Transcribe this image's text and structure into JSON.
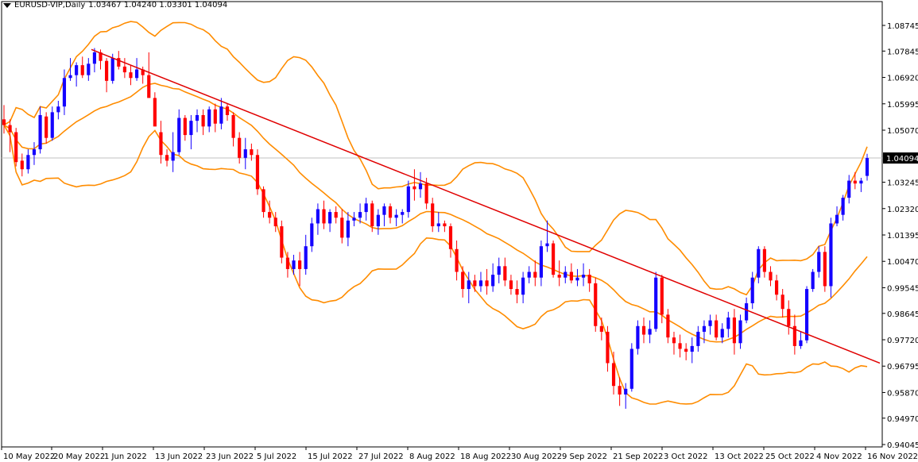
{
  "header": {
    "symbol": "EURUSD-VIP,Daily",
    "ohlc": "1.03467 1.04240 1.03301 1.04094"
  },
  "colors": {
    "bull_candle": "#1400ff",
    "bear_candle": "#ff0000",
    "bollinger": "#ff8c00",
    "trendline": "#e00000",
    "price_line": "#c0c0c0",
    "price_tag_bg": "#000000"
  },
  "chart_data": {
    "type": "candlestick",
    "title": "EURUSD-VIP,Daily",
    "last_price": 1.04094,
    "last_ohlc": {
      "open": 1.03467,
      "high": 1.0424,
      "low": 1.03301,
      "close": 1.04094
    },
    "ylim": [
      0.94,
      1.095
    ],
    "y_ticks": [
      "1.08745",
      "1.07845",
      "1.06920",
      "1.05995",
      "1.05070",
      "1.04094",
      "1.03245",
      "1.02320",
      "1.01395",
      "1.00470",
      "0.99545",
      "0.98645",
      "0.97720",
      "0.96795",
      "0.95870",
      "0.94970",
      "0.94045"
    ],
    "x_ticks": [
      "10 May 2022",
      "20 May 2022",
      "1 Jun 2022",
      "13 Jun 2022",
      "23 Jun 2022",
      "5 Jul 2022",
      "15 Jul 2022",
      "27 Jul 2022",
      "8 Aug 2022",
      "18 Aug 2022",
      "30 Aug 2022",
      "9 Sep 2022",
      "21 Sep 2022",
      "3 Oct 2022",
      "13 Oct 2022",
      "25 Oct 2022",
      "4 Nov 2022",
      "16 Nov 2022"
    ],
    "grid": false,
    "indicator": "Bollinger Bands (upper, middle, lower)",
    "trendline": {
      "start": {
        "date": "25 May 2022",
        "price": 1.079
      },
      "end": {
        "date": "16 Nov 2022",
        "price": 0.969
      }
    },
    "candles": [
      {
        "open": 1.0545,
        "high": 1.0595,
        "low": 1.0495,
        "close": 1.0525
      },
      {
        "open": 1.0525,
        "high": 1.0545,
        "low": 1.043,
        "close": 1.05
      },
      {
        "open": 1.05,
        "high": 1.0515,
        "low": 1.038,
        "close": 1.0395
      },
      {
        "open": 1.04,
        "high": 1.0425,
        "low": 1.0345,
        "close": 1.037
      },
      {
        "open": 1.037,
        "high": 1.044,
        "low": 1.0355,
        "close": 1.042
      },
      {
        "open": 1.042,
        "high": 1.0465,
        "low": 1.0385,
        "close": 1.044
      },
      {
        "open": 1.044,
        "high": 1.059,
        "low": 1.0425,
        "close": 1.056
      },
      {
        "open": 1.0555,
        "high": 1.057,
        "low": 1.046,
        "close": 1.048
      },
      {
        "open": 1.048,
        "high": 1.059,
        "low": 1.047,
        "close": 1.057
      },
      {
        "open": 1.057,
        "high": 1.061,
        "low": 1.0545,
        "close": 1.059
      },
      {
        "open": 1.059,
        "high": 1.072,
        "low": 1.056,
        "close": 1.069
      },
      {
        "open": 1.069,
        "high": 1.076,
        "low": 1.068,
        "close": 1.07
      },
      {
        "open": 1.07,
        "high": 1.0745,
        "low": 1.066,
        "close": 1.0735
      },
      {
        "open": 1.0735,
        "high": 1.0765,
        "low": 1.069,
        "close": 1.07
      },
      {
        "open": 1.07,
        "high": 1.076,
        "low": 1.068,
        "close": 1.074
      },
      {
        "open": 1.074,
        "high": 1.0795,
        "low": 1.071,
        "close": 1.078
      },
      {
        "open": 1.078,
        "high": 1.079,
        "low": 1.072,
        "close": 1.075
      },
      {
        "open": 1.075,
        "high": 1.076,
        "low": 1.064,
        "close": 1.068
      },
      {
        "open": 1.068,
        "high": 1.0775,
        "low": 1.067,
        "close": 1.076
      },
      {
        "open": 1.076,
        "high": 1.0785,
        "low": 1.072,
        "close": 1.073
      },
      {
        "open": 1.073,
        "high": 1.076,
        "low": 1.069,
        "close": 1.071
      },
      {
        "open": 1.071,
        "high": 1.0735,
        "low": 1.0665,
        "close": 1.069
      },
      {
        "open": 1.069,
        "high": 1.076,
        "low": 1.068,
        "close": 1.072
      },
      {
        "open": 1.072,
        "high": 1.073,
        "low": 1.067,
        "close": 1.07
      },
      {
        "open": 1.07,
        "high": 1.078,
        "low": 1.065,
        "close": 1.062
      },
      {
        "open": 1.062,
        "high": 1.064,
        "low": 1.055,
        "close": 1.052
      },
      {
        "open": 1.05,
        "high": 1.054,
        "low": 1.039,
        "close": 1.042
      },
      {
        "open": 1.042,
        "high": 1.044,
        "low": 1.038,
        "close": 1.04
      },
      {
        "open": 1.04,
        "high": 1.05,
        "low": 1.036,
        "close": 1.043
      },
      {
        "open": 1.043,
        "high": 1.058,
        "low": 1.042,
        "close": 1.055
      },
      {
        "open": 1.055,
        "high": 1.056,
        "low": 1.047,
        "close": 1.049
      },
      {
        "open": 1.049,
        "high": 1.056,
        "low": 1.044,
        "close": 1.054
      },
      {
        "open": 1.054,
        "high": 1.058,
        "low": 1.05,
        "close": 1.056
      },
      {
        "open": 1.056,
        "high": 1.058,
        "low": 1.049,
        "close": 1.052
      },
      {
        "open": 1.052,
        "high": 1.059,
        "low": 1.05,
        "close": 1.058
      },
      {
        "open": 1.058,
        "high": 1.06,
        "low": 1.05,
        "close": 1.053
      },
      {
        "open": 1.053,
        "high": 1.062,
        "low": 1.051,
        "close": 1.059
      },
      {
        "open": 1.059,
        "high": 1.06,
        "low": 1.054,
        "close": 1.056
      },
      {
        "open": 1.056,
        "high": 1.057,
        "low": 1.045,
        "close": 1.048
      },
      {
        "open": 1.048,
        "high": 1.05,
        "low": 1.039,
        "close": 1.041
      },
      {
        "open": 1.041,
        "high": 1.048,
        "low": 1.037,
        "close": 1.044
      },
      {
        "open": 1.044,
        "high": 1.046,
        "low": 1.04,
        "close": 1.042
      },
      {
        "open": 1.042,
        "high": 1.044,
        "low": 1.028,
        "close": 1.03
      },
      {
        "open": 1.03,
        "high": 1.031,
        "low": 1.02,
        "close": 1.022
      },
      {
        "open": 1.022,
        "high": 1.026,
        "low": 1.018,
        "close": 1.02
      },
      {
        "open": 1.02,
        "high": 1.022,
        "low": 1.015,
        "close": 1.017
      },
      {
        "open": 1.017,
        "high": 1.019,
        "low": 1.004,
        "close": 1.006
      },
      {
        "open": 1.006,
        "high": 1.008,
        "low": 0.999,
        "close": 1.002
      },
      {
        "open": 1.002,
        "high": 1.007,
        "low": 1.0,
        "close": 1.005
      },
      {
        "open": 1.005,
        "high": 1.008,
        "low": 0.996,
        "close": 1.002
      },
      {
        "open": 1.002,
        "high": 1.014,
        "low": 1.0,
        "close": 1.01
      },
      {
        "open": 1.01,
        "high": 1.02,
        "low": 1.008,
        "close": 1.018
      },
      {
        "open": 1.018,
        "high": 1.025,
        "low": 1.014,
        "close": 1.023
      },
      {
        "open": 1.023,
        "high": 1.026,
        "low": 1.016,
        "close": 1.018
      },
      {
        "open": 1.018,
        "high": 1.023,
        "low": 1.015,
        "close": 1.022
      },
      {
        "open": 1.022,
        "high": 1.024,
        "low": 1.018,
        "close": 1.02
      },
      {
        "open": 1.02,
        "high": 1.023,
        "low": 1.011,
        "close": 1.013
      },
      {
        "open": 1.013,
        "high": 1.022,
        "low": 1.01,
        "close": 1.019
      },
      {
        "open": 1.019,
        "high": 1.022,
        "low": 1.017,
        "close": 1.02
      },
      {
        "open": 1.02,
        "high": 1.025,
        "low": 1.018,
        "close": 1.022
      },
      {
        "open": 1.022,
        "high": 1.027,
        "low": 1.019,
        "close": 1.025
      },
      {
        "open": 1.025,
        "high": 1.026,
        "low": 1.015,
        "close": 1.017
      },
      {
        "open": 1.017,
        "high": 1.023,
        "low": 1.014,
        "close": 1.021
      },
      {
        "open": 1.021,
        "high": 1.025,
        "low": 1.017,
        "close": 1.024
      },
      {
        "open": 1.024,
        "high": 1.025,
        "low": 1.018,
        "close": 1.02
      },
      {
        "open": 1.02,
        "high": 1.023,
        "low": 1.017,
        "close": 1.021
      },
      {
        "open": 1.021,
        "high": 1.023,
        "low": 1.018,
        "close": 1.022
      },
      {
        "open": 1.022,
        "high": 1.033,
        "low": 1.02,
        "close": 1.031
      },
      {
        "open": 1.031,
        "high": 1.037,
        "low": 1.026,
        "close": 1.03
      },
      {
        "open": 1.03,
        "high": 1.036,
        "low": 1.027,
        "close": 1.032
      },
      {
        "open": 1.032,
        "high": 1.034,
        "low": 1.023,
        "close": 1.025
      },
      {
        "open": 1.025,
        "high": 1.027,
        "low": 1.015,
        "close": 1.017
      },
      {
        "open": 1.017,
        "high": 1.022,
        "low": 1.015,
        "close": 1.018
      },
      {
        "open": 1.018,
        "high": 1.019,
        "low": 1.015,
        "close": 1.017
      },
      {
        "open": 1.017,
        "high": 1.018,
        "low": 1.006,
        "close": 1.009
      },
      {
        "open": 1.009,
        "high": 1.012,
        "low": 0.998,
        "close": 1.001
      },
      {
        "open": 1.001,
        "high": 1.003,
        "low": 0.992,
        "close": 0.995
      },
      {
        "open": 0.995,
        "high": 1.001,
        "low": 0.99,
        "close": 0.998
      },
      {
        "open": 0.998,
        "high": 1.0,
        "low": 0.994,
        "close": 0.996
      },
      {
        "open": 0.996,
        "high": 1.001,
        "low": 0.994,
        "close": 0.998
      },
      {
        "open": 0.998,
        "high": 1.002,
        "low": 0.993,
        "close": 0.996
      },
      {
        "open": 0.996,
        "high": 1.004,
        "low": 0.994,
        "close": 1.0
      },
      {
        "open": 1.0,
        "high": 1.006,
        "low": 0.997,
        "close": 1.003
      },
      {
        "open": 1.003,
        "high": 1.006,
        "low": 0.996,
        "close": 0.998
      },
      {
        "open": 0.998,
        "high": 1.0,
        "low": 0.993,
        "close": 0.995
      },
      {
        "open": 0.995,
        "high": 0.998,
        "low": 0.99,
        "close": 0.993
      },
      {
        "open": 0.993,
        "high": 1.001,
        "low": 0.99,
        "close": 0.999
      },
      {
        "open": 0.999,
        "high": 1.003,
        "low": 0.997,
        "close": 1.001
      },
      {
        "open": 1.001,
        "high": 1.005,
        "low": 0.996,
        "close": 0.999
      },
      {
        "open": 0.999,
        "high": 1.012,
        "low": 0.996,
        "close": 1.01
      },
      {
        "open": 1.01,
        "high": 1.019,
        "low": 1.008,
        "close": 1.011
      },
      {
        "open": 1.011,
        "high": 1.012,
        "low": 0.999,
        "close": 1.0
      },
      {
        "open": 1.0,
        "high": 1.005,
        "low": 0.996,
        "close": 0.999
      },
      {
        "open": 0.999,
        "high": 1.003,
        "low": 0.997,
        "close": 1.001
      },
      {
        "open": 1.001,
        "high": 1.004,
        "low": 0.997,
        "close": 0.998
      },
      {
        "open": 0.998,
        "high": 1.002,
        "low": 0.996,
        "close": 0.999
      },
      {
        "open": 0.999,
        "high": 1.004,
        "low": 0.996,
        "close": 1.0
      },
      {
        "open": 1.0,
        "high": 1.002,
        "low": 0.994,
        "close": 0.997
      },
      {
        "open": 0.997,
        "high": 0.999,
        "low": 0.98,
        "close": 0.982
      },
      {
        "open": 0.982,
        "high": 0.985,
        "low": 0.977,
        "close": 0.98
      },
      {
        "open": 0.98,
        "high": 0.982,
        "low": 0.966,
        "close": 0.969
      },
      {
        "open": 0.969,
        "high": 0.973,
        "low": 0.958,
        "close": 0.961
      },
      {
        "open": 0.961,
        "high": 0.964,
        "low": 0.954,
        "close": 0.958
      },
      {
        "open": 0.958,
        "high": 0.962,
        "low": 0.953,
        "close": 0.96
      },
      {
        "open": 0.96,
        "high": 0.976,
        "low": 0.959,
        "close": 0.974
      },
      {
        "open": 0.974,
        "high": 0.984,
        "low": 0.972,
        "close": 0.982
      },
      {
        "open": 0.982,
        "high": 0.985,
        "low": 0.976,
        "close": 0.979
      },
      {
        "open": 0.979,
        "high": 0.984,
        "low": 0.976,
        "close": 0.981
      },
      {
        "open": 0.981,
        "high": 1.001,
        "low": 0.98,
        "close": 0.999
      },
      {
        "open": 0.999,
        "high": 1.0,
        "low": 0.983,
        "close": 0.986
      },
      {
        "open": 0.986,
        "high": 0.988,
        "low": 0.976,
        "close": 0.978
      },
      {
        "open": 0.978,
        "high": 0.98,
        "low": 0.972,
        "close": 0.976
      },
      {
        "open": 0.976,
        "high": 0.979,
        "low": 0.971,
        "close": 0.974
      },
      {
        "open": 0.974,
        "high": 0.976,
        "low": 0.97,
        "close": 0.973
      },
      {
        "open": 0.973,
        "high": 0.978,
        "low": 0.969,
        "close": 0.975
      },
      {
        "open": 0.975,
        "high": 0.982,
        "low": 0.973,
        "close": 0.98
      },
      {
        "open": 0.98,
        "high": 0.984,
        "low": 0.976,
        "close": 0.982
      },
      {
        "open": 0.982,
        "high": 0.986,
        "low": 0.979,
        "close": 0.984
      },
      {
        "open": 0.984,
        "high": 0.986,
        "low": 0.977,
        "close": 0.978
      },
      {
        "open": 0.978,
        "high": 0.983,
        "low": 0.976,
        "close": 0.981
      },
      {
        "open": 0.981,
        "high": 0.987,
        "low": 0.978,
        "close": 0.985
      },
      {
        "open": 0.985,
        "high": 0.988,
        "low": 0.972,
        "close": 0.976
      },
      {
        "open": 0.976,
        "high": 0.986,
        "low": 0.974,
        "close": 0.984
      },
      {
        "open": 0.984,
        "high": 0.992,
        "low": 0.983,
        "close": 0.99
      },
      {
        "open": 0.99,
        "high": 1.001,
        "low": 0.988,
        "close": 0.999
      },
      {
        "open": 0.999,
        "high": 1.01,
        "low": 0.997,
        "close": 1.009
      },
      {
        "open": 1.009,
        "high": 1.01,
        "low": 0.999,
        "close": 1.001
      },
      {
        "open": 1.001,
        "high": 1.003,
        "low": 0.996,
        "close": 0.998
      },
      {
        "open": 0.998,
        "high": 1.0,
        "low": 0.991,
        "close": 0.993
      },
      {
        "open": 0.993,
        "high": 0.995,
        "low": 0.985,
        "close": 0.988
      },
      {
        "open": 0.988,
        "high": 0.991,
        "low": 0.979,
        "close": 0.982
      },
      {
        "open": 0.982,
        "high": 0.986,
        "low": 0.972,
        "close": 0.975
      },
      {
        "open": 0.975,
        "high": 0.98,
        "low": 0.974,
        "close": 0.977
      },
      {
        "open": 0.977,
        "high": 0.996,
        "low": 0.976,
        "close": 0.995
      },
      {
        "open": 0.995,
        "high": 1.002,
        "low": 0.994,
        "close": 1.001
      },
      {
        "open": 1.001,
        "high": 1.01,
        "low": 0.999,
        "close": 1.008
      },
      {
        "open": 1.008,
        "high": 1.01,
        "low": 0.994,
        "close": 0.996
      },
      {
        "open": 0.996,
        "high": 1.02,
        "low": 0.992,
        "close": 1.018
      },
      {
        "open": 1.018,
        "high": 1.024,
        "low": 1.017,
        "close": 1.021
      },
      {
        "open": 1.021,
        "high": 1.028,
        "low": 1.019,
        "close": 1.027
      },
      {
        "open": 1.027,
        "high": 1.035,
        "low": 1.025,
        "close": 1.033
      },
      {
        "open": 1.033,
        "high": 1.036,
        "low": 1.03,
        "close": 1.032
      },
      {
        "open": 1.032,
        "high": 1.034,
        "low": 1.029,
        "close": 1.033
      },
      {
        "open": 1.03467,
        "high": 1.0424,
        "low": 1.03301,
        "close": 1.04094
      }
    ]
  }
}
